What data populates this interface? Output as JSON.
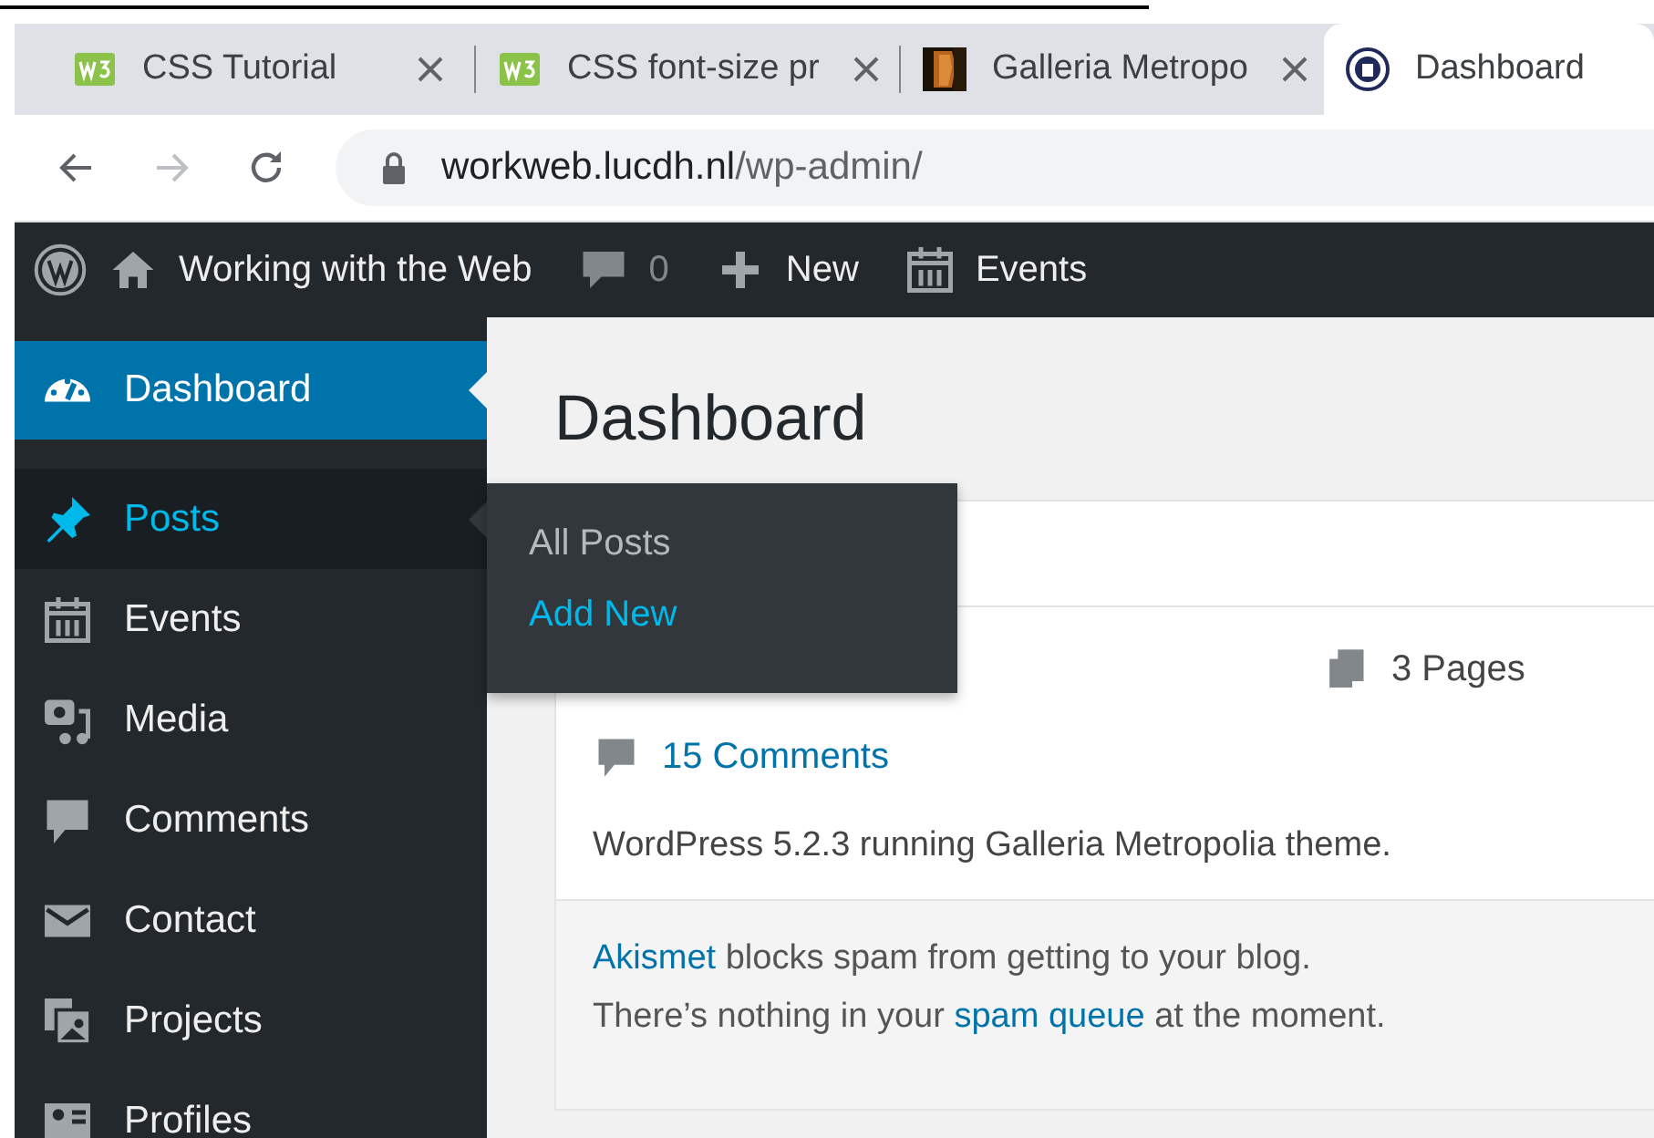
{
  "browser": {
    "tabs": [
      {
        "title": "CSS Tutorial",
        "kind": "w3",
        "selected": false
      },
      {
        "title": "CSS font-size pr",
        "kind": "w3",
        "selected": false
      },
      {
        "title": "Galleria Metropo",
        "kind": "picture",
        "selected": false
      },
      {
        "title": "Dashboard",
        "kind": "seal",
        "selected": true
      }
    ],
    "url": {
      "host": "workweb.lucdh.nl",
      "path": "/wp-admin/"
    }
  },
  "admin_bar": {
    "site": "Working with the Web",
    "comments": "0",
    "new": "New",
    "events": "Events"
  },
  "sidebar": {
    "items": [
      {
        "label": "Dashboard",
        "kind": "gauge",
        "selected": true,
        "highlighted": false
      },
      {
        "label": "Posts",
        "kind": "pin",
        "selected": false,
        "highlighted": true
      },
      {
        "label": "Events",
        "kind": "calendar",
        "selected": false,
        "highlighted": false
      },
      {
        "label": "Media",
        "kind": "media",
        "selected": false,
        "highlighted": false
      },
      {
        "label": "Comments",
        "kind": "comment",
        "selected": false,
        "highlighted": false
      },
      {
        "label": "Contact",
        "kind": "mail",
        "selected": false,
        "highlighted": false
      },
      {
        "label": "Projects",
        "kind": "images",
        "selected": false,
        "highlighted": false
      },
      {
        "label": "Profiles",
        "kind": "profile",
        "selected": false,
        "highlighted": false
      }
    ]
  },
  "flyout": {
    "items": [
      {
        "label": "All Posts",
        "highlighted": false
      },
      {
        "label": "Add New",
        "highlighted": true
      }
    ]
  },
  "page": {
    "title": "Dashboard",
    "glance": {
      "pages": "3 Pages",
      "comments": "15 Comments",
      "version": "WordPress 5.2.3 running Galleria Metropolia theme."
    },
    "akismet": [
      [
        {
          "text": "Akismet",
          "link": true
        },
        {
          "text": " blocks spam from getting to your blog.",
          "link": false
        }
      ],
      [
        {
          "text": "There’s nothing in your ",
          "link": false
        },
        {
          "text": "spam queue",
          "link": true
        },
        {
          "text": " at the moment.",
          "link": false
        }
      ]
    ]
  }
}
